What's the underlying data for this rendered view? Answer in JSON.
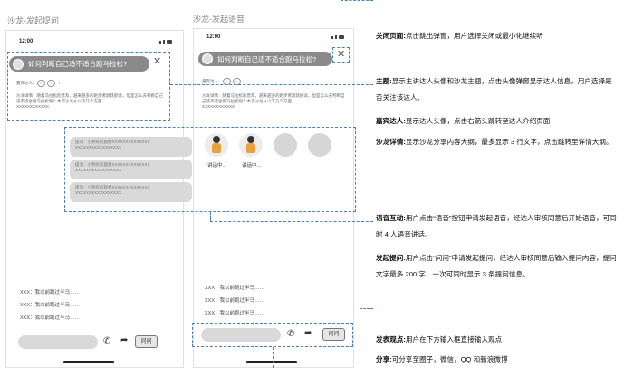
{
  "left_screen": {
    "title": "沙龙-发起提问",
    "time": "12:00",
    "question": "如何判断自己适不适合跑马拉松?",
    "guest_label": "嘉宾达人:",
    "detail": "沙龙详情：随着马拉松的普及，越来越多的跑步者跃跃欲试，但是怎么去判断自己适不适合跑马拉松呢？本次沙龙从以下几个方面",
    "detail_tail": "XXXXXXXXXXXX",
    "cards": [
      {
        "text": "提问：小明有问题想XXXXXXXXXXXXXX XXXXXXXXXXXXXXXXX"
      },
      {
        "text": "提问：小明有问题想XXXXXXXXXXXXXX XXXXXXXXXXXXXXXXX"
      },
      {
        "text": "提问：小明有问题想XXXXXXXXXXXXXX XXXXXXXXXXXXXXXXX"
      }
    ],
    "comments": [
      "XXX：我以前跑过半马……",
      "XXX：我以前跑过半马……",
      "XXX：我以前跑过半马……"
    ],
    "ask_label": "问问"
  },
  "right_screen": {
    "title": "沙龙-发起语音",
    "time": "12:00",
    "question": "如何判断自己适不适合跑马拉松?",
    "guest_label": "嘉宾达人:",
    "detail": "沙龙详情：随着马拉松的普及，越来越多的跑步者跃跃欲试，但是怎么去判断自己适不适合跑马拉松呢？本次沙龙从以下几个方面",
    "detail_tail": "XXXXXXXXXXXX",
    "speakers": [
      {
        "label": "讲话中..."
      },
      {
        "label": "讲话中..."
      }
    ],
    "comments": [
      "XXX：我以前跑过半马……",
      "XXX：我以前跑过半马……",
      "XXX：我以前跑过半马……"
    ],
    "ask_label": "问问"
  },
  "notes": {
    "close": {
      "title": "关闭页面:",
      "body": "点击跳出弹窗，用户选择关闭或最小化继续听"
    },
    "topic": {
      "title": "主题:",
      "body": "显示主讲达人头像和沙龙主题，点击头像弹窗显示达人信息，用户选择是否关注该达人。"
    },
    "guest": {
      "title": "嘉宾达人:",
      "body": "显示达人头像，点击右箭头跳转至达人介绍页面"
    },
    "detail": {
      "title": "沙龙详情:",
      "body": "显示沙龙分享内容大纲，最多显示 3 行文字，点击跳转至详情大纲。"
    },
    "voice": {
      "title": "语音互动:",
      "body": "用户点击“语音”按钮申请发起语音，经达人审核同意后开始语音，可同时 4 人语音讲话。"
    },
    "ask": {
      "title": "发起提问:",
      "body": "用户点击“问问”申请发起提问，经达人审核同意后输入提问内容，提问文字最多 200 字，一次可同时显示 3 条提问信息。"
    },
    "opinion": {
      "title": "发表观点:",
      "body": "用户在下方输入框直接输入观点"
    },
    "share": {
      "title": "分享:",
      "body": "可分享至圈子，微信，QQ 和新浪微博"
    }
  }
}
